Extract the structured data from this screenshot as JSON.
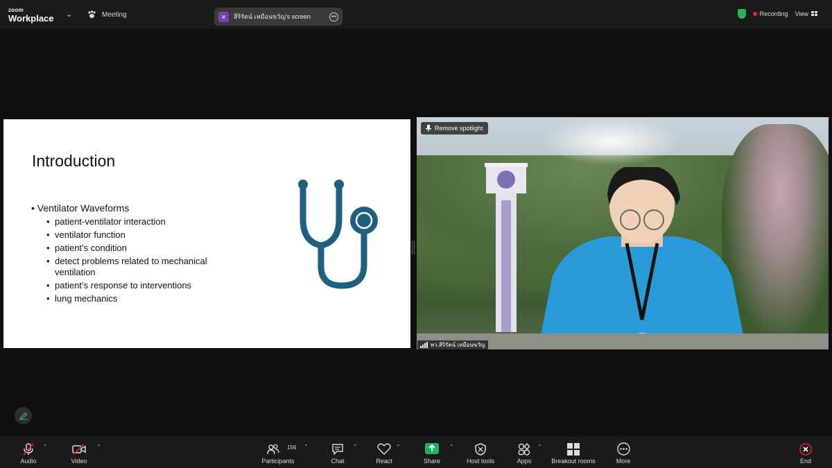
{
  "app": {
    "brand_top": "zoom",
    "brand_bottom": "Workplace",
    "meeting_label": "Meeting",
    "screen_share_initial": "ส",
    "screen_share_label": "สิริรัตน์ เหมือนขวัญ's screen",
    "recording_label": "Recording",
    "view_label": "View"
  },
  "slide": {
    "title": "Introduction",
    "level1": "Ventilator Waveforms",
    "bullets": [
      "patient-ventilator interaction",
      "ventilator function",
      "patient’s condition",
      "detect problems related to mechanical ventilation",
      "patient’s response to interventions",
      "lung mechanics"
    ],
    "icon": "stethoscope-icon",
    "icon_color": "#1f5f7f"
  },
  "video": {
    "spotlight_label": "Remove spotlight",
    "participant_name": "พว.สิริรัตน์ เหมือนขวัญ"
  },
  "toolbar": {
    "audio": "Audio",
    "video": "Video",
    "participants": "Participants",
    "participant_count": "156",
    "chat": "Chat",
    "react": "React",
    "share": "Share",
    "host_tools": "Host tools",
    "apps": "Apps",
    "breakout": "Breakout rooms",
    "more": "More",
    "end": "End",
    "share_color": "#1bb35a",
    "end_color": "#e02828"
  }
}
